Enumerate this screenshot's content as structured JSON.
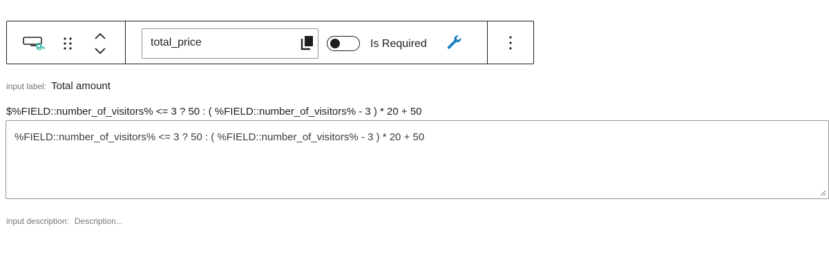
{
  "toolbar": {
    "block_icon": "block-type-icon",
    "drag_icon": "drag-handle-icon",
    "mover_icon": "move-up-down-icon",
    "field_name": "total_price",
    "copy_icon": "copy-icon",
    "required_toggle_on": false,
    "required_label": "Is Required",
    "settings_icon": "wrench-icon",
    "more_icon": "more-vertical-icon"
  },
  "input_label": {
    "caption": "input label:",
    "value": "Total amount"
  },
  "formula": {
    "heading": "$%FIELD::number_of_visitors% <= 3 ? 50 : ( %FIELD::number_of_visitors% - 3 ) * 20 + 50",
    "value": "%FIELD::number_of_visitors% <= 3 ? 50 : ( %FIELD::number_of_visitors% - 3 ) * 20 + 50"
  },
  "input_description": {
    "caption": "input description:",
    "placeholder": "Description..."
  },
  "colors": {
    "accent": "#3858e9",
    "teal": "#2fb5a5",
    "wrench": "#1e7fc3",
    "border": "#1e1e1e"
  }
}
